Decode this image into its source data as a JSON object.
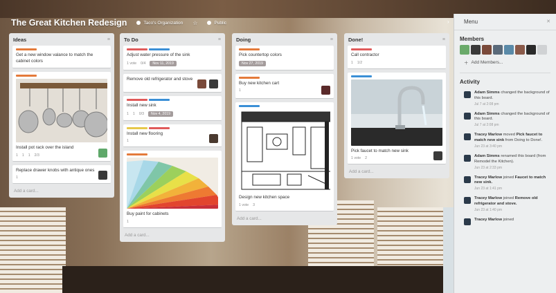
{
  "board": {
    "title": "The Great Kitchen Redesign",
    "organization": "Taco's Organization",
    "visibility": "Public"
  },
  "lists": [
    {
      "title": "Ideas",
      "cards": [
        {
          "text": "Get a new window valance to match the cabinet colors",
          "labels": [
            "#e47a3a"
          ]
        },
        {
          "text": "Install pot rack over the island",
          "labels": [
            "#e47a3a"
          ],
          "badges": {
            "votes": "1",
            "comments": "1",
            "attachments": "1",
            "checklist": "2/3"
          }
        },
        {
          "text": "Replace drawer knobs with antique ones",
          "labels": [],
          "badges": {
            "votes": "1"
          }
        }
      ],
      "add_card": "Add a card..."
    },
    {
      "title": "To Do",
      "cards": [
        {
          "text": "Adjust water pressure of the sink",
          "labels": [
            "#e05a5a",
            "#3a8fd6"
          ],
          "badges": {
            "votes": "1 vote",
            "checklist": "0/4",
            "due": "Nov 11, 2019"
          }
        },
        {
          "text": "Remove old refrigerator and stove",
          "labels": [],
          "badges": {}
        },
        {
          "text": "Install new sink",
          "labels": [
            "#e05a5a",
            "#3a8fd6"
          ],
          "badges": {
            "votes": "1",
            "comments": "1",
            "checklist": "0/3",
            "due": "Nov 4, 2019"
          }
        },
        {
          "text": "Install new flooring",
          "labels": [
            "#e6c84a",
            "#e05a5a"
          ],
          "badges": {
            "votes": "1"
          }
        },
        {
          "text": "Buy paint for cabinets",
          "labels": [
            "#e47a3a"
          ],
          "badges": {
            "votes": "1"
          }
        }
      ],
      "add_card": "Add a card..."
    },
    {
      "title": "Doing",
      "cards": [
        {
          "text": "Pick countertop colors",
          "labels": [
            "#e47a3a"
          ],
          "badges": {
            "due": "Nov 27, 2019"
          }
        },
        {
          "text": "Buy new kitchen cart",
          "labels": [
            "#e47a3a"
          ],
          "badges": {
            "votes": "1"
          }
        },
        {
          "text": "Design new kitchen space",
          "labels": [
            "#3a8fd6"
          ],
          "badges": {
            "votes": "1 vote",
            "checklist": "3"
          }
        }
      ],
      "add_card": "Add a card..."
    },
    {
      "title": "Done!",
      "cards": [
        {
          "text": "Call contractor",
          "labels": [
            "#e05a5a"
          ],
          "badges": {
            "votes": "1",
            "checklist": "1/2"
          }
        },
        {
          "text": "Pick faucet to match new sink",
          "labels": [
            "#3a8fd6"
          ],
          "badges": {
            "votes": "1 vote",
            "checklist": "2"
          }
        }
      ],
      "add_card": "Add a card..."
    }
  ],
  "menu": {
    "title": "Menu",
    "members_title": "Members",
    "add_members": "Add Members...",
    "activity_title": "Activity",
    "activity": [
      {
        "actor": "Adam Simms",
        "text": " changed the background of this board.",
        "time": "Jul 7 at 2:08 pm"
      },
      {
        "actor": "Adam Simms",
        "text": " changed the background of this board.",
        "time": "Jul 7 at 2:08 pm"
      },
      {
        "actor": "Tracey Marlow",
        "text": " moved ",
        "target": "Pick faucet to match new sink",
        "tail": " from Doing to Done!.",
        "time": "Jun 23 at 3:40 pm"
      },
      {
        "actor": "Adam Simms",
        "text": " renamed this board (from Remodel the Kitchen).",
        "time": "Jun 23 at 2:33 pm"
      },
      {
        "actor": "Tracey Marlow",
        "text": " joined ",
        "target": "Faucet to match new sink.",
        "tail": "",
        "time": "Jun 23 at 1:41 pm"
      },
      {
        "actor": "Tracey Marlow",
        "text": " joined ",
        "target": "Remove old refrigerator and stove.",
        "tail": "",
        "time": "Jun 23 at 1:40 pm"
      },
      {
        "actor": "Tracey Marlow",
        "text": " joined",
        "time": ""
      }
    ]
  },
  "colors": {
    "list_bg": "#e6e7e8",
    "menu_bg": "#edeff0",
    "date_badge": "#a49c9c",
    "activity_icon": "#2b3a4a"
  }
}
